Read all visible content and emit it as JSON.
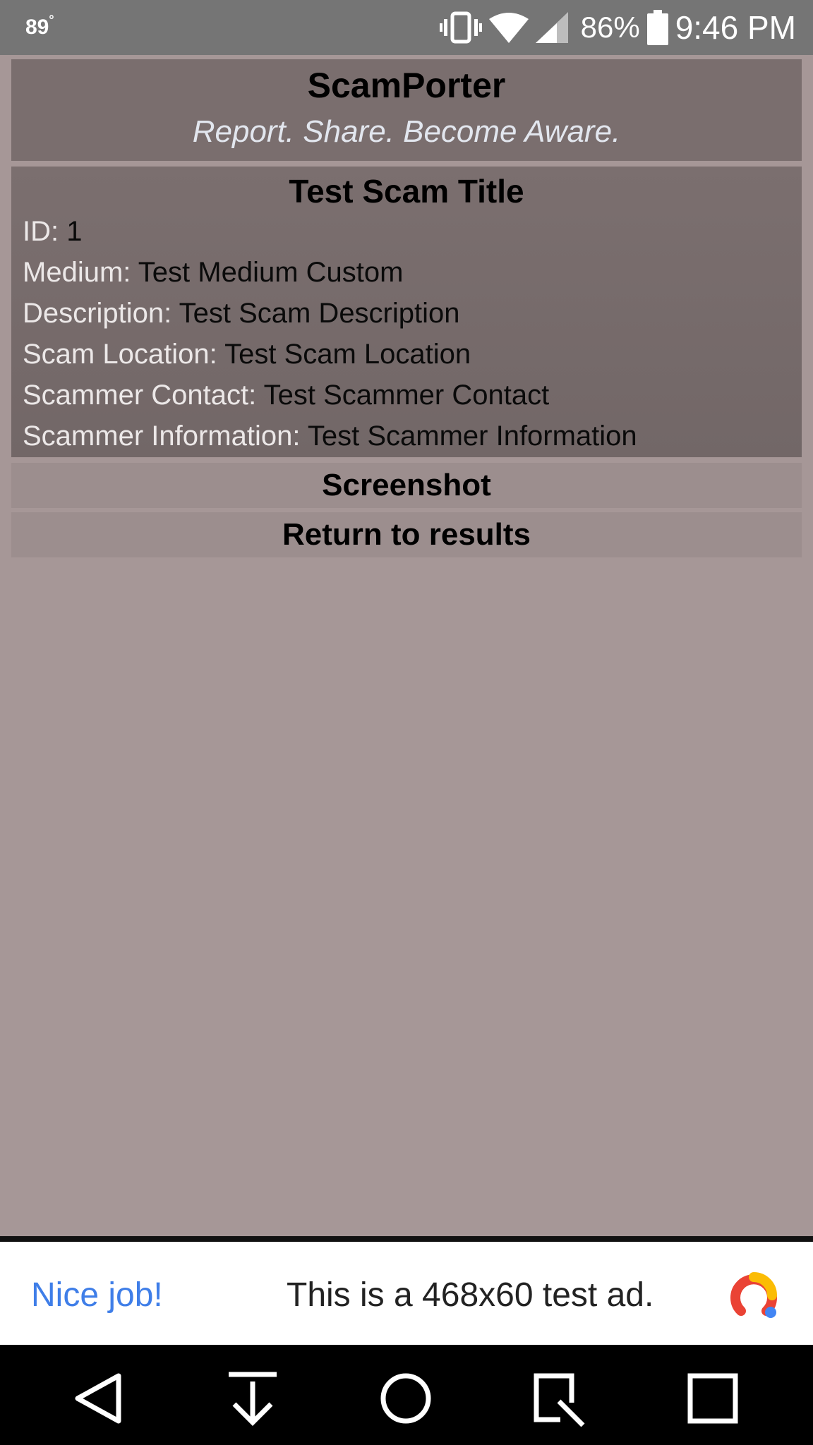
{
  "status_bar": {
    "temperature": "89",
    "temperature_unit": "°",
    "battery_percent": "86%",
    "clock": "9:46 PM",
    "icons": [
      "vibrate-icon",
      "wifi-icon",
      "cell-signal-icon",
      "battery-icon"
    ]
  },
  "header": {
    "title": "ScamPorter",
    "tagline": "Report. Share. Become Aware."
  },
  "scam": {
    "title": "Test Scam Title",
    "fields": [
      {
        "label": "ID:",
        "value": "1"
      },
      {
        "label": "Medium:",
        "value": "Test Medium Custom"
      },
      {
        "label": "Description:",
        "value": "Test Scam Description"
      },
      {
        "label": "Scam Location:",
        "value": "Test Scam Location"
      },
      {
        "label": "Scammer Contact:",
        "value": "Test Scammer Contact"
      },
      {
        "label": "Scammer Information:",
        "value": "Test Scammer Information"
      }
    ]
  },
  "buttons": {
    "screenshot": "Screenshot",
    "return": "Return to results"
  },
  "ad": {
    "nice": "Nice job!",
    "text": "This is a 468x60 test ad.",
    "logo_icon": "adsense-logo-icon"
  },
  "nav": {
    "icons": [
      "back-icon",
      "download-icon",
      "home-icon",
      "search-icon",
      "recents-icon"
    ]
  },
  "colors": {
    "background": "#a69797",
    "header_panel": "#7a6e6e",
    "button_panel": "#9c8e8e",
    "tagline": "#e2e6ee",
    "ad_link": "#3f7ee8"
  }
}
